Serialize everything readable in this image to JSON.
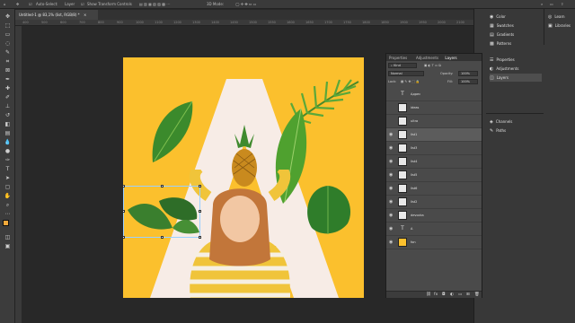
{
  "options_bar": {
    "auto_select_label": "Auto-Select:",
    "auto_select_value": "Layer",
    "show_transform_label": "Show Transform Controls",
    "mode_label": "3D Mode:"
  },
  "document": {
    "tab_title": "Untitled-1 @ 83,1% (list, RGB/8) *"
  },
  "ruler_top": [
    "400",
    "500",
    "600",
    "700",
    "800",
    "900",
    "1000",
    "1100",
    "1200",
    "1300",
    "1400",
    "1450",
    "1500",
    "1550",
    "1600",
    "1650",
    "1700",
    "1750",
    "1800",
    "1850",
    "1900",
    "1950",
    "2000",
    "2100"
  ],
  "right_dock": {
    "group1": [
      {
        "label": "Color",
        "icon": "color-wheel-icon"
      },
      {
        "label": "Swatches",
        "icon": "swatches-icon"
      },
      {
        "label": "Gradients",
        "icon": "gradient-icon"
      },
      {
        "label": "Patterns",
        "icon": "pattern-icon"
      },
      {
        "label": "Properties",
        "icon": "properties-icon"
      },
      {
        "label": "Adjustments",
        "icon": "adjustments-icon"
      },
      {
        "label": "Layers",
        "icon": "layers-icon"
      }
    ],
    "group2": [
      {
        "label": "Channels",
        "icon": "channels-icon"
      },
      {
        "label": "Paths",
        "icon": "paths-icon"
      }
    ],
    "group3": [
      {
        "label": "Learn",
        "icon": "learn-icon"
      },
      {
        "label": "Libraries",
        "icon": "libraries-icon"
      }
    ]
  },
  "layers_panel": {
    "tabs": [
      "Properties",
      "Adjustments",
      "Layers"
    ],
    "active_tab": "Layers",
    "filter_label": "Kind",
    "blend_mode": "Normal",
    "opacity_label": "Opacity:",
    "opacity_value": "100%",
    "lock_label": "Lock:",
    "fill_label": "Fill:",
    "fill_value": "100%",
    "layers": [
      {
        "name": "Адрес",
        "type": "text",
        "visible": false,
        "selected": false
      },
      {
        "name": "ideas",
        "type": "image",
        "visible": false,
        "selected": false
      },
      {
        "name": "ultra",
        "type": "image",
        "visible": false,
        "selected": false
      },
      {
        "name": "list1",
        "type": "image",
        "visible": true,
        "selected": true
      },
      {
        "name": "list3",
        "type": "image",
        "visible": true,
        "selected": false
      },
      {
        "name": "list4",
        "type": "image",
        "visible": true,
        "selected": false
      },
      {
        "name": "list5",
        "type": "image",
        "visible": true,
        "selected": false
      },
      {
        "name": "list6",
        "type": "image",
        "visible": true,
        "selected": false
      },
      {
        "name": "list2",
        "type": "image",
        "visible": true,
        "selected": false
      },
      {
        "name": "devocka",
        "type": "image",
        "visible": true,
        "selected": false
      },
      {
        "name": "A",
        "type": "text",
        "visible": true,
        "selected": false
      },
      {
        "name": "fon",
        "type": "fill",
        "visible": true,
        "selected": false
      }
    ],
    "footer_icons": [
      "link-icon",
      "fx-icon",
      "mask-icon",
      "adjustment-layer-icon",
      "group-icon",
      "new-layer-icon",
      "trash-icon"
    ]
  },
  "colors": {
    "background_yellow": "#fbc02d",
    "letter_white": "#f7ece6",
    "ui_dark": "#282828"
  }
}
